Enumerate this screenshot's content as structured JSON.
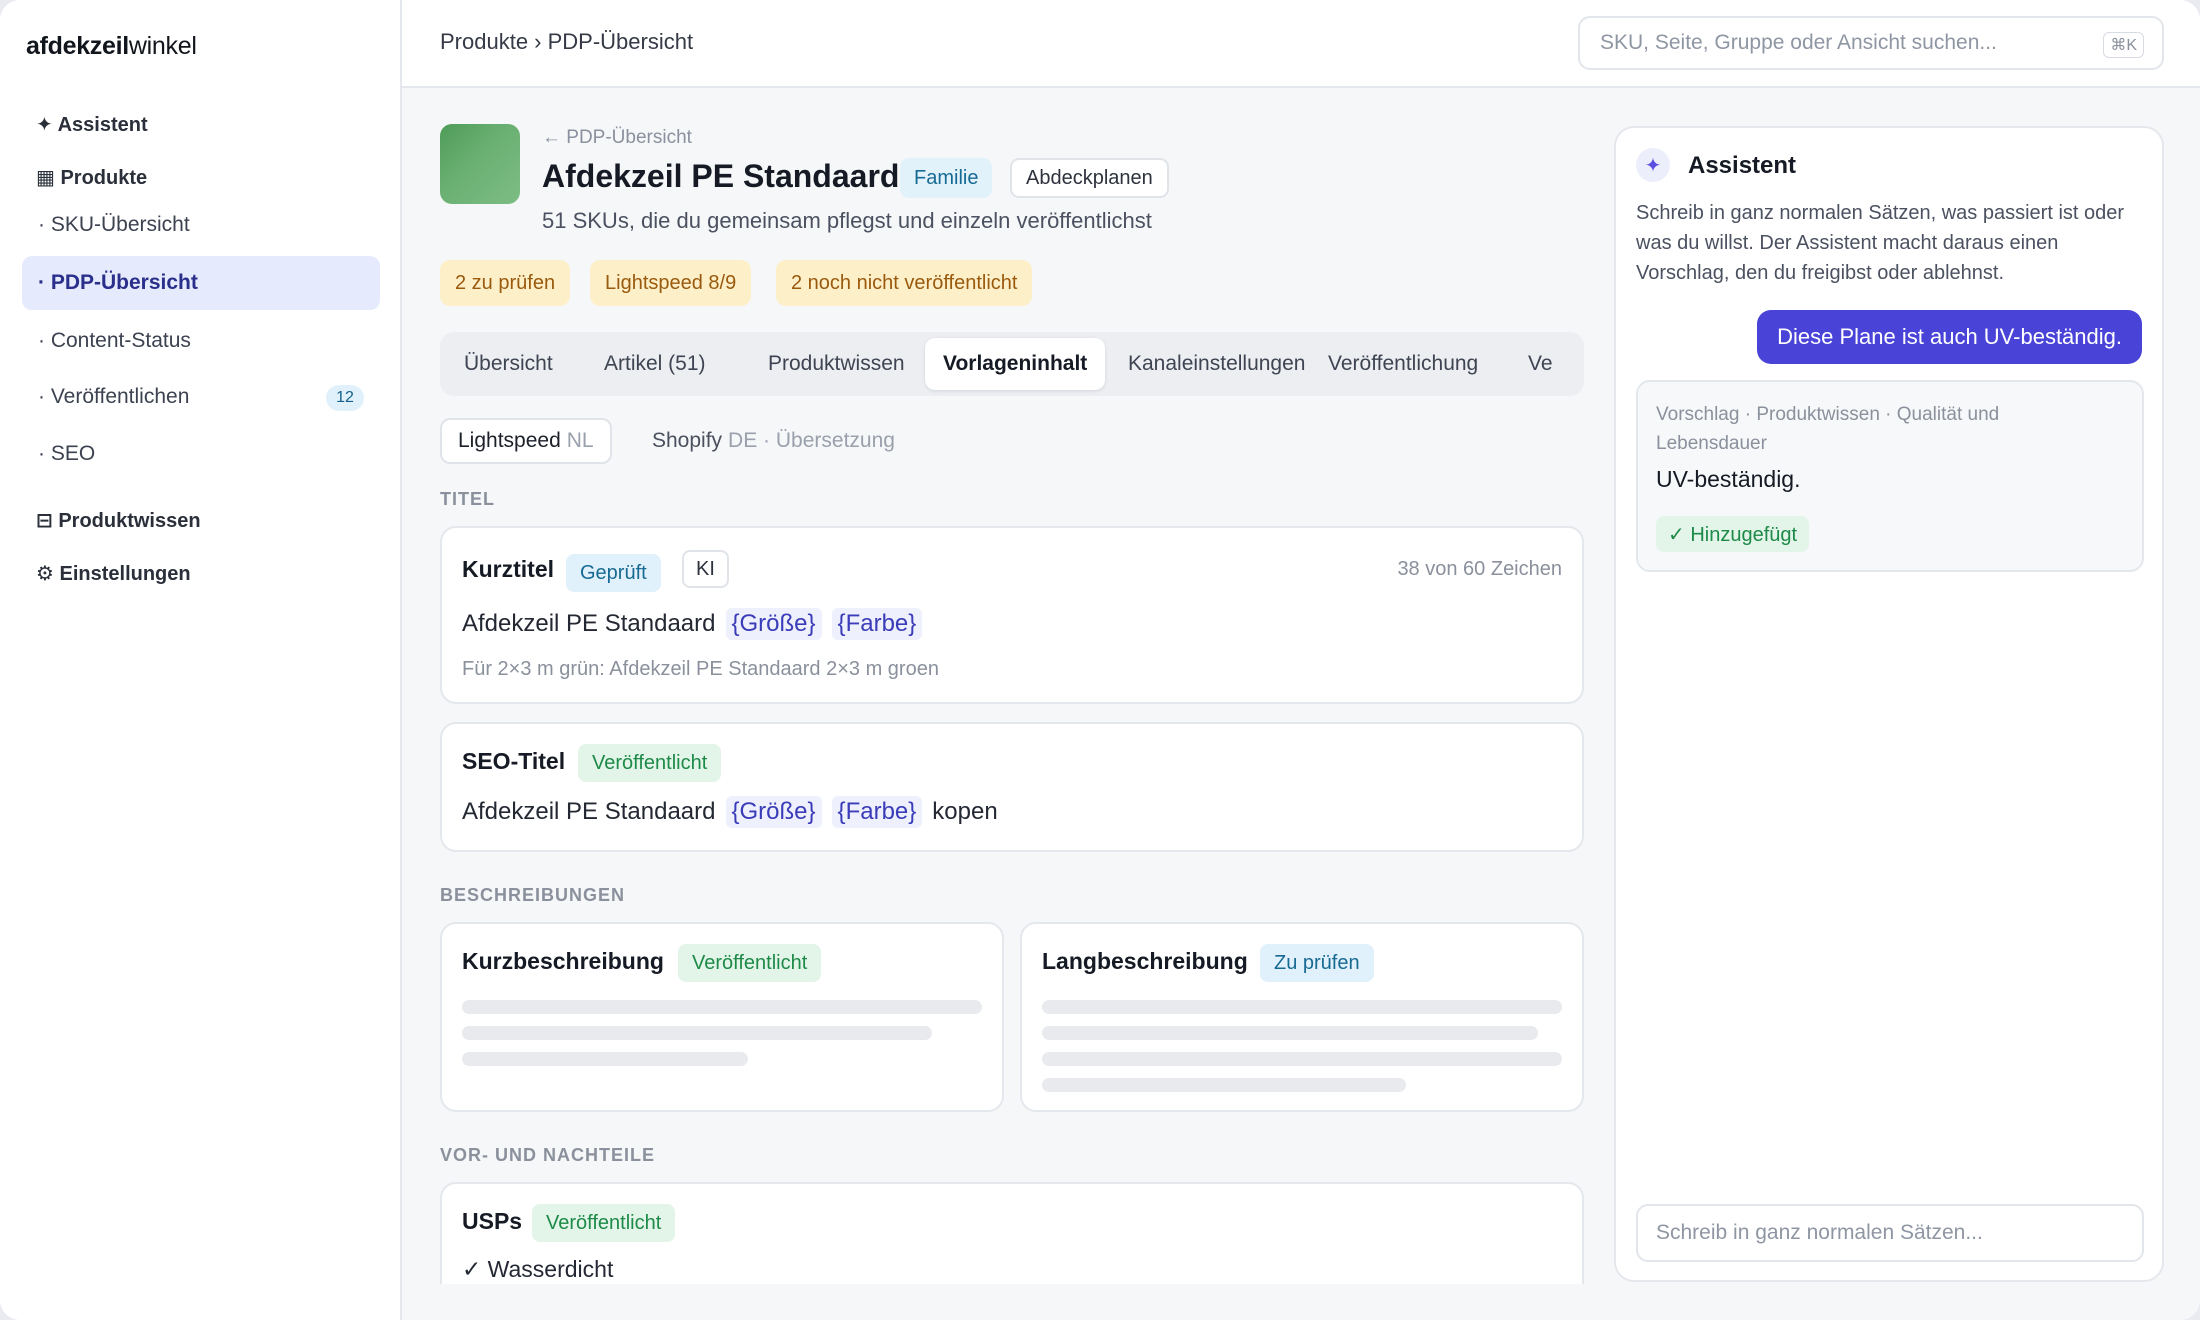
{
  "sidebar": {
    "logo_bold": "afdekzeil",
    "logo_rest": "winkel",
    "assistant": "✦ Assistent",
    "products": "▦ Produkte",
    "items": [
      {
        "label": "· SKU-Übersicht"
      },
      {
        "label": "· PDP-Übersicht"
      },
      {
        "label": "· Content-Status"
      },
      {
        "label": "· Veröffentlichen",
        "badge": "12"
      },
      {
        "label": "· SEO"
      }
    ],
    "knowledge": "⊟ Produktwissen",
    "settings": "⚙ Einstellungen"
  },
  "topbar": {
    "breadcrumb": "Produkte › PDP-Übersicht",
    "search_placeholder": "SKU, Seite, Gruppe oder Ansicht suchen...",
    "shortcut": "⌘K"
  },
  "product": {
    "back": "← PDP-Übersicht",
    "title": "Afdekzeil PE Standaard",
    "chip_family": "Familie",
    "chip_category": "Abdeckplanen",
    "subtitle": "51 SKUs, die du gemeinsam pflegst und einzeln veröffentlichst",
    "status": [
      "2 zu prüfen",
      "Lightspeed 8/9",
      "2 noch nicht veröffentlicht"
    ]
  },
  "tabs": [
    "Übersicht",
    "Artikel (51)",
    "Produktwissen",
    "Vorlageninhalt",
    "Kanaleinstellungen",
    "Veröffentlichung",
    "Ve"
  ],
  "channels": {
    "lightspeed": "Lightspeed",
    "lightspeed_lang": "NL",
    "shopify": "Shopify",
    "shopify_lang": "DE · Übersetzung"
  },
  "sections": {
    "titel": "TITEL",
    "beschreibungen": "BESCHREIBUNGEN",
    "vor_nachteile": "VOR- UND NACHTEILE"
  },
  "kurztitel": {
    "title": "Kurztitel",
    "badge": "Geprüft",
    "ai": "KI",
    "chars": "38 von 60 Zeichen",
    "text": "Afdekzeil PE Standaard",
    "token_size": "{Größe}",
    "token_color": "{Farbe}",
    "hint": "Für 2×3 m grün: Afdekzeil PE Standaard 2×3 m groen"
  },
  "seotitel": {
    "title": "SEO-Titel",
    "badge": "Veröffentlicht",
    "text": "Afdekzeil PE Standaard",
    "token_size": "{Größe}",
    "token_color": "{Farbe}",
    "suffix": "kopen"
  },
  "kurzbeschreibung": {
    "title": "Kurzbeschreibung",
    "badge": "Veröffentlicht"
  },
  "langbeschreibung": {
    "title": "Langbeschreibung",
    "badge": "Zu prüfen"
  },
  "usps": {
    "title": "USPs",
    "badge": "Veröffentlicht",
    "first": "✓ Wasserdicht"
  },
  "assistant": {
    "icon": "✦",
    "title": "Assistent",
    "intro": "Schreib in ganz normalen Sätzen, was passiert ist oder was du willst. Der Assistent macht daraus einen Vorschlag, den du freigibst oder ablehnst.",
    "user_message": "Diese Plane ist auch UV-beständig.",
    "suggestion_meta": "Vorschlag · Produktwissen · Qualität und Lebensdauer",
    "suggestion_text": "UV-beständig.",
    "suggestion_status": "✓ Hinzugefügt",
    "input_placeholder": "Schreib in ganz normalen Sätzen..."
  },
  "colors": {
    "accent": "#4a43d8",
    "nav_active_bg": "#e5ebfd",
    "status_warn_bg": "#fdf0c9",
    "badge_green": "#1e8a48",
    "badge_blue": "#176a93"
  }
}
